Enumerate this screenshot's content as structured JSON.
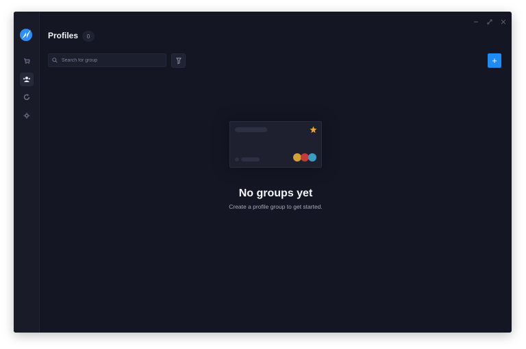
{
  "app": {
    "sidebar": {
      "items": [
        {
          "name": "tasks",
          "icon": "cart-icon",
          "active": false
        },
        {
          "name": "profiles",
          "icon": "users-icon",
          "active": true
        },
        {
          "name": "proxies",
          "icon": "refresh-icon",
          "active": false
        },
        {
          "name": "settings",
          "icon": "gear-icon",
          "active": false
        }
      ]
    },
    "header": {
      "title": "Profiles",
      "count": "0"
    },
    "search": {
      "placeholder": "Search for group",
      "value": ""
    },
    "add_button_label": "+",
    "window_controls": [
      "minimize",
      "maximize",
      "close"
    ],
    "empty_state": {
      "title": "No groups yet",
      "subtitle": "Create a profile group to get started.",
      "illustration_dot_colors": [
        "#d4a03a",
        "#c23b3b",
        "#3e9ac0"
      ],
      "star_color": "#f0a040"
    },
    "colors": {
      "accent": "#1e8cf0",
      "background": "#141624",
      "sidebar": "#191b29"
    }
  }
}
